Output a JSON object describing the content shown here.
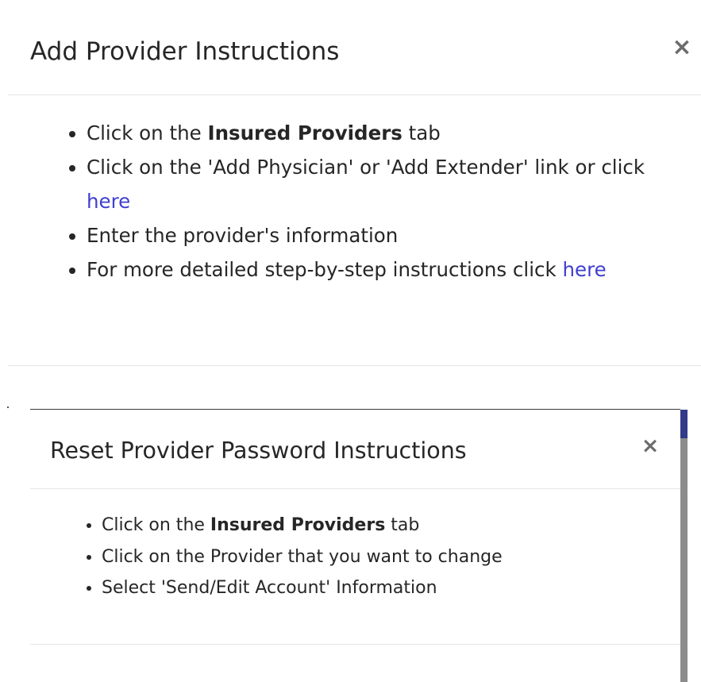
{
  "add_modal": {
    "title": "Add Provider Instructions",
    "close_symbol": "×",
    "items": [
      {
        "pre": "Click on the ",
        "bold": "Insured Providers",
        "post": " tab"
      },
      {
        "pre": "Click on the 'Add Physician' or 'Add Extender' link or click ",
        "link": "here"
      },
      {
        "pre": "Enter the provider's information"
      },
      {
        "pre": "For more detailed step-by-step instructions click ",
        "link": "here"
      }
    ]
  },
  "reset_modal": {
    "title": "Reset Provider Password Instructions",
    "close_symbol": "×",
    "items": [
      {
        "pre": "Click on the ",
        "bold": "Insured Providers",
        "post": " tab"
      },
      {
        "pre": "Click on the Provider that you want to change"
      },
      {
        "pre": "Select 'Send/Edit Account' Information"
      }
    ]
  },
  "colors": {
    "link": "#3f3fd1",
    "accent": "#333a8a",
    "scrollbar": "#8c8c8c",
    "divider": "#e5e5e5"
  }
}
